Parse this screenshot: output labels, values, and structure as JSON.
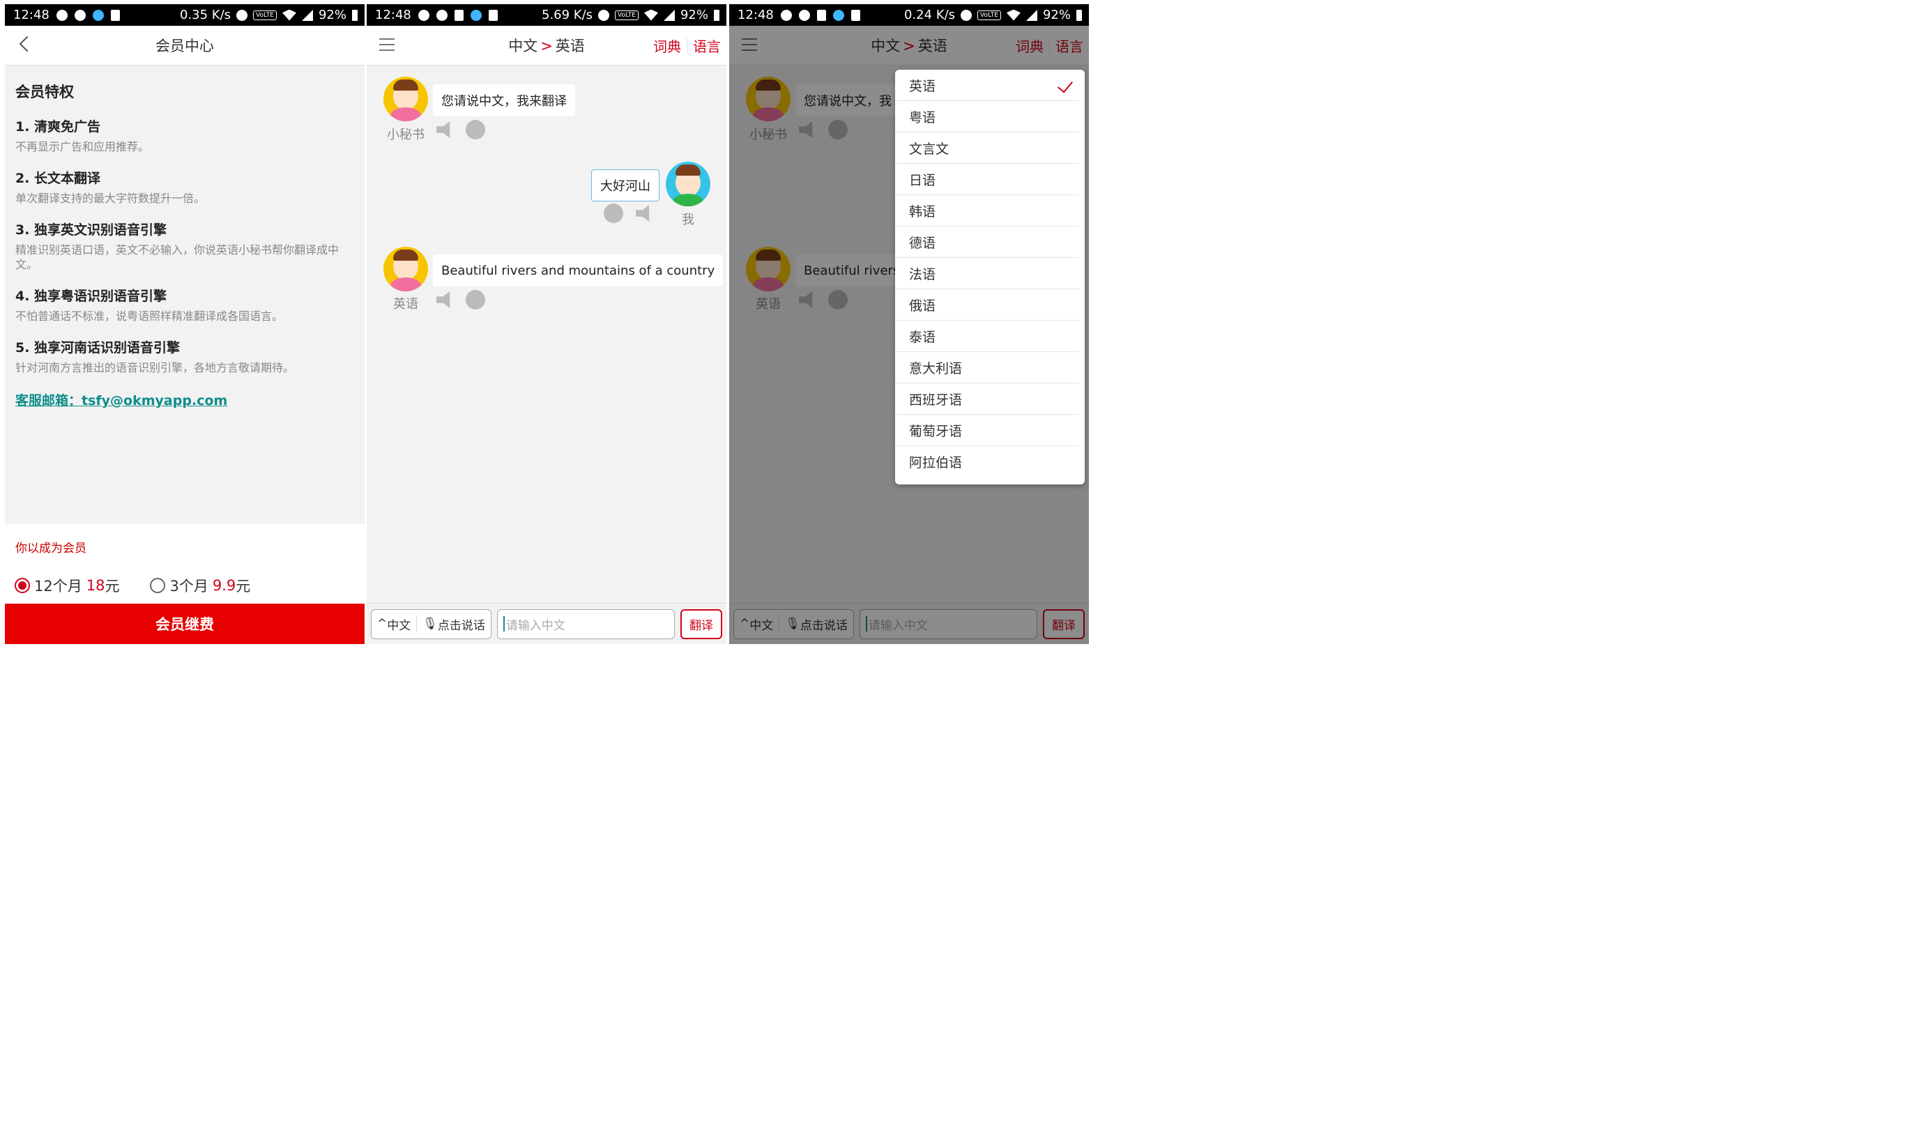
{
  "status_bars": [
    {
      "time": "12:48",
      "speed": "0.35 K/s",
      "battery": "92%"
    },
    {
      "time": "12:48",
      "speed": "5.69 K/s",
      "battery": "92%"
    },
    {
      "time": "12:48",
      "speed": "0.24 K/s",
      "battery": "92%"
    }
  ],
  "volte": "VoLTE",
  "member": {
    "title": "会员中心",
    "heading": "会员特权",
    "perks": [
      {
        "title": "1. 清爽免广告",
        "desc": "不再显示广告和应用推荐。"
      },
      {
        "title": "2. 长文本翻译",
        "desc": "单次翻译支持的最大字符数提升一倍。"
      },
      {
        "title": "3. 独享英文识别语音引擎",
        "desc": "精准识别英语口语，英文不必输入，你说英语小秘书帮你翻译成中文。"
      },
      {
        "title": "4. 独享粤语识别语音引擎",
        "desc": "不怕普通话不标准，说粤语照样精准翻译成各国语言。"
      },
      {
        "title": "5. 独享河南话识别语音引擎",
        "desc": "针对河南方言推出的语音识别引擎，各地方言敬请期待。"
      }
    ],
    "email": "客服邮箱：tsfy@okmyapp.com",
    "note": "你以成为会员",
    "plans": [
      {
        "months": "12个月",
        "price": "18",
        "unit": "元",
        "selected": true
      },
      {
        "months": "3个月",
        "price": "9.9",
        "unit": "元",
        "selected": false
      }
    ],
    "pay_button": "会员继费"
  },
  "translator": {
    "from_lang": "中文",
    "arrow": ">",
    "to_lang": "英语",
    "dict_label": "词典",
    "lang_label": "语言",
    "messages": [
      {
        "sender": "小秘书",
        "text": "您请说中文，我来翻译"
      },
      {
        "sender": "我",
        "text": "大好河山"
      },
      {
        "sender": "英语",
        "text": "Beautiful rivers and mountains of a country"
      }
    ],
    "messages_truncated": {
      "first": "您请说中文，我",
      "third": "Beautiful rivers"
    },
    "bottom": {
      "lang_toggle": "中文",
      "voice_button": "点击说话",
      "placeholder": "请输入中文",
      "translate_button": "翻译"
    }
  },
  "language_menu": {
    "selected": "英语",
    "items": [
      "英语",
      "粤语",
      "文言文",
      "日语",
      "韩语",
      "德语",
      "法语",
      "俄语",
      "泰语",
      "意大利语",
      "西班牙语",
      "葡萄牙语",
      "阿拉伯语"
    ]
  },
  "colors": {
    "accent": "#d0021b",
    "pay": "#e60000",
    "email": "#0e8e8a"
  }
}
